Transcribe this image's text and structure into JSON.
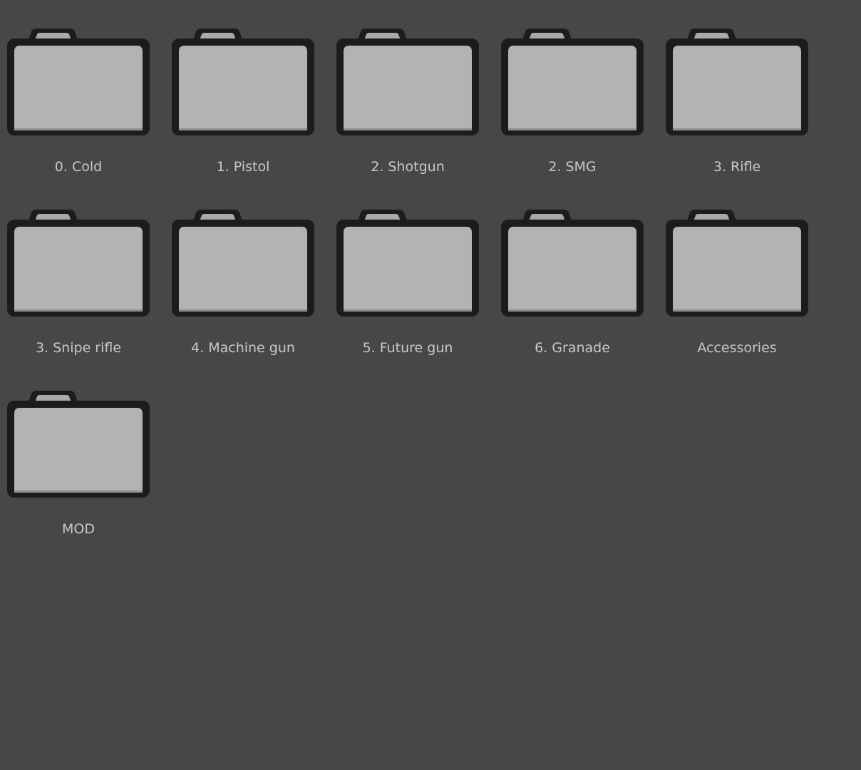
{
  "folders": [
    {
      "label": "0. Cold",
      "icon": "folder-icon"
    },
    {
      "label": "1. Pistol",
      "icon": "folder-icon"
    },
    {
      "label": "2. Shotgun",
      "icon": "folder-icon"
    },
    {
      "label": "2. SMG",
      "icon": "folder-icon"
    },
    {
      "label": "3. Rifle",
      "icon": "folder-icon"
    },
    {
      "label": "3. Snipe rifle",
      "icon": "folder-icon"
    },
    {
      "label": "4. Machine gun",
      "icon": "folder-icon"
    },
    {
      "label": "5. Future gun",
      "icon": "folder-icon"
    },
    {
      "label": "6. Granade",
      "icon": "folder-icon"
    },
    {
      "label": "Accessories",
      "icon": "folder-icon"
    },
    {
      "label": "MOD",
      "icon": "folder-icon"
    }
  ],
  "colors": {
    "background": "#474747",
    "folder_outline": "#1c1c1c",
    "folder_fill": "#b3b3b3",
    "label_text": "#c8c8c8"
  }
}
